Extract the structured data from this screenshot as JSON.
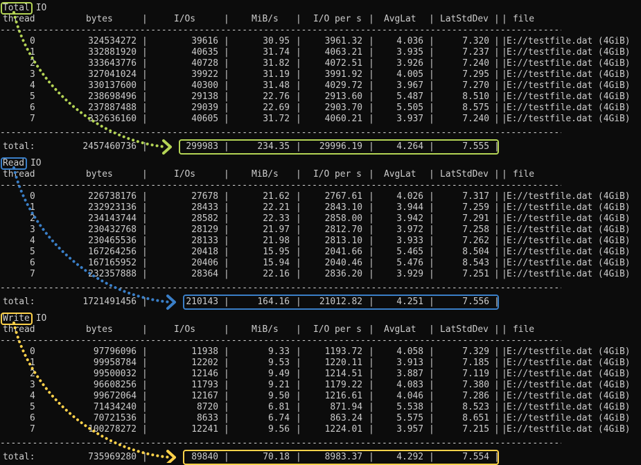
{
  "columns": {
    "thread": "thread",
    "bytes": "bytes",
    "ios": "I/Os",
    "mibs": "MiB/s",
    "iops": "I/O per s",
    "avglat": "AvgLat",
    "latstd": "LatStdDev",
    "file": "file"
  },
  "total_label": "total:",
  "colors": {
    "total": "#b4d455",
    "read": "#3a7fc8",
    "write": "#ffd24a"
  },
  "sections": [
    {
      "key": "total",
      "word": "Total",
      "suffix": "IO",
      "rows": [
        [
          "0",
          "324534272",
          "39616",
          "30.95",
          "3961.32",
          "4.036",
          "7.320",
          "E://testfile.dat (4GiB)"
        ],
        [
          "1",
          "332881920",
          "40635",
          "31.74",
          "4063.21",
          "3.935",
          "7.237",
          "E://testfile.dat (4GiB)"
        ],
        [
          "2",
          "333643776",
          "40728",
          "31.82",
          "4072.51",
          "3.926",
          "7.240",
          "E://testfile.dat (4GiB)"
        ],
        [
          "3",
          "327041024",
          "39922",
          "31.19",
          "3991.92",
          "4.005",
          "7.295",
          "E://testfile.dat (4GiB)"
        ],
        [
          "4",
          "330137600",
          "40300",
          "31.48",
          "4029.72",
          "3.967",
          "7.270",
          "E://testfile.dat (4GiB)"
        ],
        [
          "5",
          "238698496",
          "29138",
          "22.76",
          "2913.60",
          "5.487",
          "8.510",
          "E://testfile.dat (4GiB)"
        ],
        [
          "6",
          "237887488",
          "29039",
          "22.69",
          "2903.70",
          "5.505",
          "8.575",
          "E://testfile.dat (4GiB)"
        ],
        [
          "7",
          "332636160",
          "40605",
          "31.72",
          "4060.21",
          "3.937",
          "7.240",
          "E://testfile.dat (4GiB)"
        ]
      ],
      "total": {
        "bytes": "2457460736",
        "ios": "299983",
        "mibs": "234.35",
        "iops": "29996.19",
        "avglat": "4.264",
        "latstd": "7.555"
      }
    },
    {
      "key": "read",
      "word": "Read",
      "suffix": "IO",
      "rows": [
        [
          "0",
          "226738176",
          "27678",
          "21.62",
          "2767.61",
          "4.026",
          "7.317",
          "E://testfile.dat (4GiB)"
        ],
        [
          "1",
          "232923136",
          "28433",
          "22.21",
          "2843.10",
          "3.944",
          "7.259",
          "E://testfile.dat (4GiB)"
        ],
        [
          "2",
          "234143744",
          "28582",
          "22.33",
          "2858.00",
          "3.942",
          "7.291",
          "E://testfile.dat (4GiB)"
        ],
        [
          "3",
          "230432768",
          "28129",
          "21.97",
          "2812.70",
          "3.972",
          "7.258",
          "E://testfile.dat (4GiB)"
        ],
        [
          "4",
          "230465536",
          "28133",
          "21.98",
          "2813.10",
          "3.933",
          "7.262",
          "E://testfile.dat (4GiB)"
        ],
        [
          "5",
          "167264256",
          "20418",
          "15.95",
          "2041.66",
          "5.465",
          "8.504",
          "E://testfile.dat (4GiB)"
        ],
        [
          "6",
          "167165952",
          "20406",
          "15.94",
          "2040.46",
          "5.476",
          "8.543",
          "E://testfile.dat (4GiB)"
        ],
        [
          "7",
          "232357888",
          "28364",
          "22.16",
          "2836.20",
          "3.929",
          "7.251",
          "E://testfile.dat (4GiB)"
        ]
      ],
      "total": {
        "bytes": "1721491456",
        "ios": "210143",
        "mibs": "164.16",
        "iops": "21012.82",
        "avglat": "4.251",
        "latstd": "7.556"
      }
    },
    {
      "key": "write",
      "word": "Write",
      "suffix": "IO",
      "rows": [
        [
          "0",
          "97796096",
          "11938",
          "9.33",
          "1193.72",
          "4.058",
          "7.329",
          "E://testfile.dat (4GiB)"
        ],
        [
          "1",
          "99958784",
          "12202",
          "9.53",
          "1220.11",
          "3.913",
          "7.185",
          "E://testfile.dat (4GiB)"
        ],
        [
          "2",
          "99500032",
          "12146",
          "9.49",
          "1214.51",
          "3.887",
          "7.119",
          "E://testfile.dat (4GiB)"
        ],
        [
          "3",
          "96608256",
          "11793",
          "9.21",
          "1179.22",
          "4.083",
          "7.380",
          "E://testfile.dat (4GiB)"
        ],
        [
          "4",
          "99672064",
          "12167",
          "9.50",
          "1216.61",
          "4.046",
          "7.286",
          "E://testfile.dat (4GiB)"
        ],
        [
          "5",
          "71434240",
          "8720",
          "6.81",
          "871.94",
          "5.538",
          "8.523",
          "E://testfile.dat (4GiB)"
        ],
        [
          "6",
          "70721536",
          "8633",
          "6.74",
          "863.24",
          "5.575",
          "8.651",
          "E://testfile.dat (4GiB)"
        ],
        [
          "7",
          "100278272",
          "12241",
          "9.56",
          "1224.01",
          "3.957",
          "7.215",
          "E://testfile.dat (4GiB)"
        ]
      ],
      "total": {
        "bytes": "735969280",
        "ios": "89840",
        "mibs": "70.18",
        "iops": "8983.37",
        "avglat": "4.292",
        "latstd": "7.554"
      }
    }
  ]
}
